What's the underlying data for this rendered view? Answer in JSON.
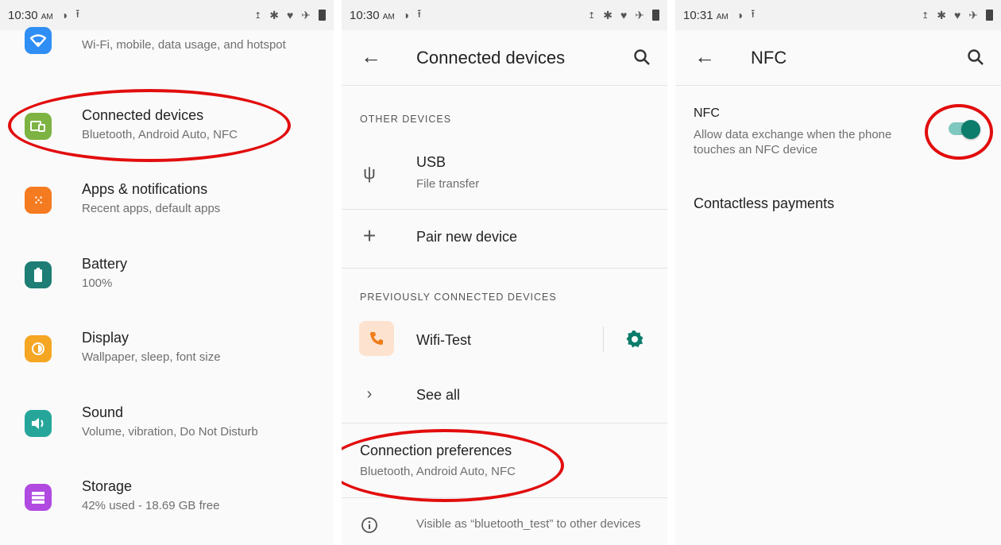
{
  "panel1": {
    "status": {
      "time": "10:30",
      "ampm": "AM"
    },
    "items": [
      {
        "title": "",
        "subtitle": "Wi-Fi, mobile, data usage, and hotspot",
        "icon": "wifi-icon",
        "color": "#2f8ef4"
      },
      {
        "title": "Connected devices",
        "subtitle": "Bluetooth, Android Auto, NFC",
        "icon": "connected-devices-icon",
        "color": "#7cb342"
      },
      {
        "title": "Apps & notifications",
        "subtitle": "Recent apps, default apps",
        "icon": "apps-icon",
        "color": "#f47b20"
      },
      {
        "title": "Battery",
        "subtitle": "100%",
        "icon": "battery-icon",
        "color": "#1e7d74"
      },
      {
        "title": "Display",
        "subtitle": "Wallpaper, sleep, font size",
        "icon": "display-icon",
        "color": "#f5a623"
      },
      {
        "title": "Sound",
        "subtitle": "Volume, vibration, Do Not Disturb",
        "icon": "sound-icon",
        "color": "#26a69a"
      },
      {
        "title": "Storage",
        "subtitle": "42% used - 18.69 GB free",
        "icon": "storage-icon",
        "color": "#b04ae0"
      }
    ]
  },
  "panel2": {
    "status": {
      "time": "10:30",
      "ampm": "AM"
    },
    "title": "Connected devices",
    "other_devices_header": "OTHER DEVICES",
    "usb": {
      "title": "USB",
      "subtitle": "File transfer"
    },
    "pair_new": "Pair new device",
    "previously_header": "PREVIOUSLY CONNECTED DEVICES",
    "wifi_test": "Wifi-Test",
    "see_all": "See all",
    "connection_prefs": {
      "title": "Connection preferences",
      "subtitle": "Bluetooth, Android Auto, NFC"
    },
    "visible_as": "Visible as “bluetooth_test” to other devices"
  },
  "panel3": {
    "status": {
      "time": "10:31",
      "ampm": "AM"
    },
    "title": "NFC",
    "nfc": {
      "title": "NFC",
      "subtitle": "Allow data exchange when the phone touches an NFC device",
      "enabled": true
    },
    "contactless": "Contactless payments"
  },
  "colors": {
    "accent": "#0c7c6b",
    "annotation": "#e20d0d"
  }
}
